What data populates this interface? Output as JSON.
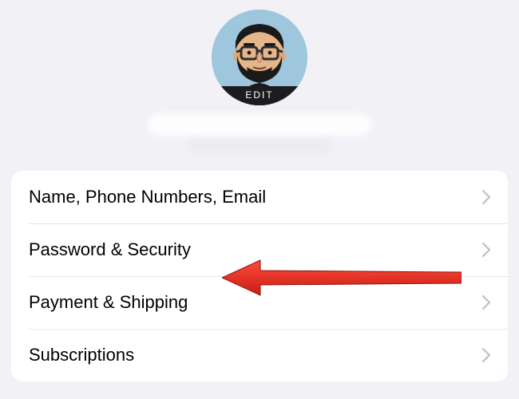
{
  "avatar": {
    "edit_label": "EDIT"
  },
  "rows": {
    "name_phone_email": {
      "label": "Name, Phone Numbers, Email"
    },
    "password_security": {
      "label": "Password & Security"
    },
    "payment_shipping": {
      "label": "Payment & Shipping"
    },
    "subscriptions": {
      "label": "Subscriptions"
    }
  },
  "annotation": {
    "points_to": "password_security"
  }
}
